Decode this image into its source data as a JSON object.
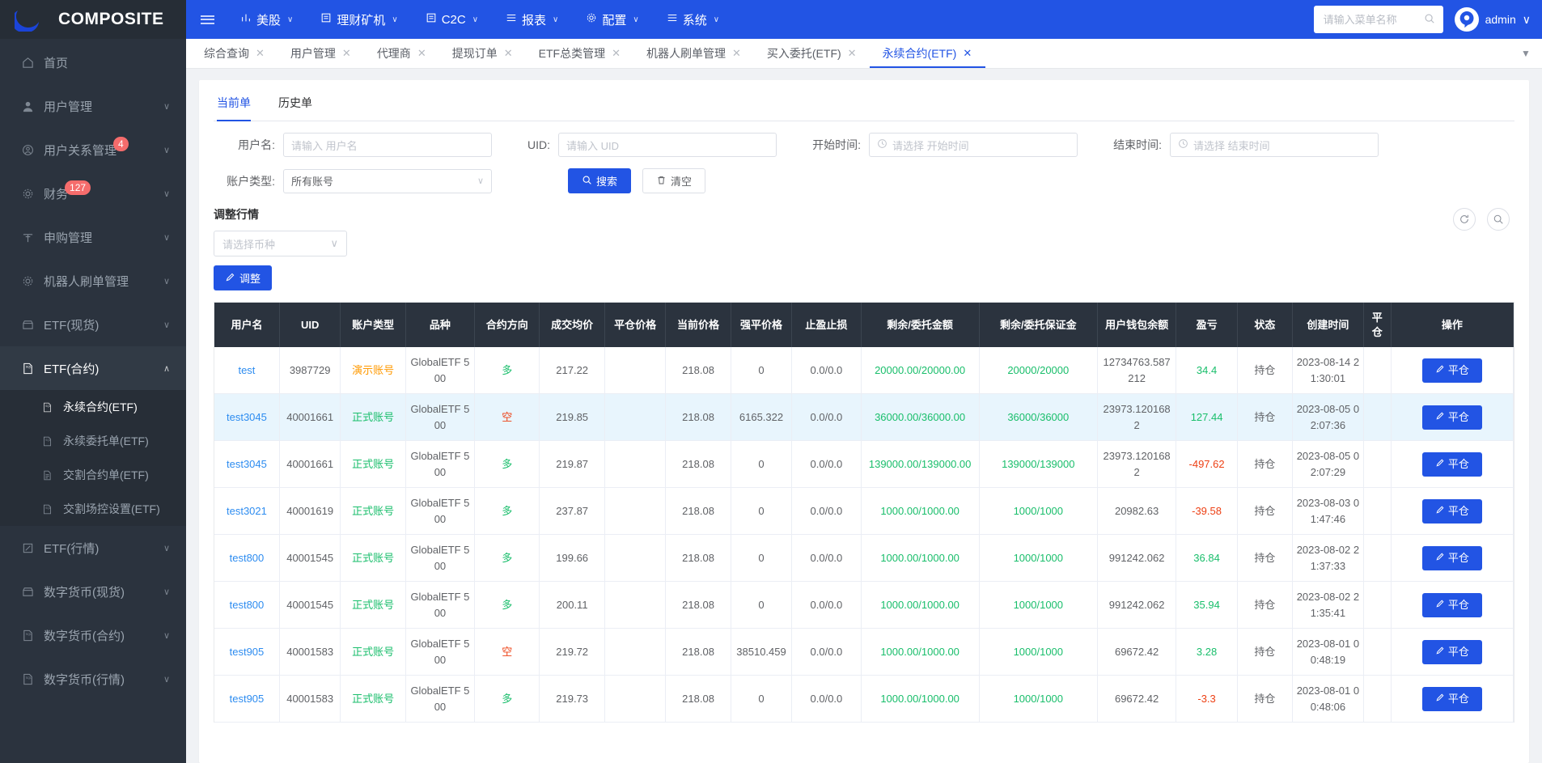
{
  "brand": {
    "name": "COMPOSITE",
    "logo_icon": "crescent-logo-icon"
  },
  "navbar": {
    "hamburger_icon": "hamburger-icon",
    "items": [
      {
        "label": "美股",
        "icon": "chart-bars-icon",
        "caret": "∨"
      },
      {
        "label": "理财矿机",
        "icon": "list-box-icon",
        "caret": "∨"
      },
      {
        "label": "C2C",
        "icon": "list-box-icon",
        "caret": "∨"
      },
      {
        "label": "报表",
        "icon": "list-lines-icon",
        "caret": "∨"
      },
      {
        "label": "配置",
        "icon": "gear-icon",
        "caret": "∨"
      },
      {
        "label": "系统",
        "icon": "list-lines-icon",
        "caret": "∨"
      }
    ],
    "search": {
      "placeholder": "请输入菜单名称",
      "icon": "search-icon"
    },
    "user": {
      "name": "admin",
      "avatar_icon": "robot-avatar-icon",
      "caret": "∨"
    }
  },
  "sidebar": {
    "items": [
      {
        "label": "首页",
        "icon": "home-icon",
        "badge": "",
        "arrow": "",
        "active": false
      },
      {
        "label": "用户管理",
        "icon": "user-icon",
        "badge": "",
        "arrow": "∨",
        "active": false
      },
      {
        "label": "用户关系管理",
        "icon": "user-circle-icon",
        "badge": "4",
        "arrow": "∨",
        "active": false
      },
      {
        "label": "财务",
        "icon": "gear-icon",
        "badge": "127",
        "arrow": "∨",
        "active": false
      },
      {
        "label": "申购管理",
        "icon": "cart-icon",
        "badge": "",
        "arrow": "∨",
        "active": false
      },
      {
        "label": "机器人刷单管理",
        "icon": "gear-icon",
        "badge": "",
        "arrow": "∨",
        "active": false
      },
      {
        "label": "ETF(现货)",
        "icon": "shop-icon",
        "badge": "",
        "arrow": "∨",
        "active": false
      },
      {
        "label": "ETF(合约)",
        "icon": "sql-doc-icon",
        "badge": "",
        "arrow": "∧",
        "active": true
      },
      {
        "label": "ETF(行情)",
        "icon": "pencil-square-icon",
        "badge": "",
        "arrow": "∨",
        "active": false
      },
      {
        "label": "数字货币(现货)",
        "icon": "shop-icon",
        "badge": "",
        "arrow": "∨",
        "active": false
      },
      {
        "label": "数字货币(合约)",
        "icon": "sql-doc-icon",
        "badge": "",
        "arrow": "∨",
        "active": false
      },
      {
        "label": "数字货币(行情)",
        "icon": "sql-doc-icon",
        "badge": "",
        "arrow": "∨",
        "active": false
      }
    ],
    "submenu": [
      {
        "label": "永续合约(ETF)",
        "icon": "sql-doc-icon",
        "active": true
      },
      {
        "label": "永续委托单(ETF)",
        "icon": "sql-doc-icon",
        "active": false
      },
      {
        "label": "交割合约单(ETF)",
        "icon": "doc-icon",
        "active": false
      },
      {
        "label": "交割场控设置(ETF)",
        "icon": "sql-doc-icon",
        "active": false
      }
    ]
  },
  "tabs": {
    "items": [
      {
        "label": "综合查询",
        "active": false
      },
      {
        "label": "用户管理",
        "active": false
      },
      {
        "label": "代理商",
        "active": false
      },
      {
        "label": "提现订单",
        "active": false
      },
      {
        "label": "ETF总类管理",
        "active": false
      },
      {
        "label": "机器人刷单管理",
        "active": false
      },
      {
        "label": "买入委托(ETF)",
        "active": false
      },
      {
        "label": "永续合约(ETF)",
        "active": true
      }
    ],
    "close_icon": "close-icon",
    "more_icon": "chevron-down-icon"
  },
  "inner_tabs": [
    {
      "label": "当前单",
      "active": true
    },
    {
      "label": "历史单",
      "active": false
    }
  ],
  "search_form": {
    "username": {
      "label": "用户名:",
      "value": "",
      "placeholder": "请输入 用户名"
    },
    "uid": {
      "label": "UID:",
      "value": "",
      "placeholder": "请输入 UID"
    },
    "start_time": {
      "label": "开始时间:",
      "value": "",
      "placeholder": "请选择 开始时间",
      "icon": "clock-icon"
    },
    "end_time": {
      "label": "结束时间:",
      "value": "",
      "placeholder": "请选择 结束时间",
      "icon": "clock-icon"
    },
    "account_type": {
      "label": "账户类型:",
      "value": "所有账号",
      "caret": "∨"
    },
    "search_button": {
      "label": "搜索",
      "icon": "search-icon"
    },
    "clear_button": {
      "label": "清空",
      "icon": "trash-icon"
    }
  },
  "adjust_panel": {
    "title": "调整行情",
    "coin_select": {
      "placeholder": "请选择币种",
      "caret": "∨"
    },
    "adjust_button": {
      "label": "调整",
      "icon": "pencil-icon"
    },
    "refresh_icon": "refresh-icon",
    "zoom_icon": "search-circle-icon"
  },
  "table": {
    "columns": [
      "用户名",
      "UID",
      "账户类型",
      "品种",
      "合约方向",
      "成交均价",
      "平仓价格",
      "当前价格",
      "强平价格",
      "止盈止损",
      "剩余/委托金额",
      "剩余/委托保证金",
      "用户钱包余额",
      "盈亏",
      "状态",
      "创建时间",
      "平仓",
      "操作"
    ],
    "action_label": "平仓",
    "action_icon": "pencil-icon",
    "rows": [
      {
        "username": "test",
        "uid": "3987729",
        "account_type": "演示账号",
        "account_type_color": "orange",
        "symbol": "GlobalETF 500",
        "direction": "多",
        "direction_color": "green",
        "avg_price": "217.22",
        "close_price": "",
        "current_price": "218.08",
        "liq_price": "0",
        "tp_sl": "0.0/0.0",
        "amount": "20000.00/20000.00",
        "margin": "20000/20000",
        "wallet": "12734763.587212",
        "pnl": "34.4",
        "pnl_color": "green",
        "status": "持仓",
        "created": "2023-08-14 21:30:01",
        "striped": false
      },
      {
        "username": "test3045",
        "uid": "40001661",
        "account_type": "正式账号",
        "account_type_color": "green",
        "symbol": "GlobalETF 500",
        "direction": "空",
        "direction_color": "red",
        "avg_price": "219.85",
        "close_price": "",
        "current_price": "218.08",
        "liq_price": "6165.322",
        "tp_sl": "0.0/0.0",
        "amount": "36000.00/36000.00",
        "margin": "36000/36000",
        "wallet": "23973.1201682",
        "pnl": "127.44",
        "pnl_color": "green",
        "status": "持仓",
        "created": "2023-08-05 02:07:36",
        "striped": true
      },
      {
        "username": "test3045",
        "uid": "40001661",
        "account_type": "正式账号",
        "account_type_color": "green",
        "symbol": "GlobalETF 500",
        "direction": "多",
        "direction_color": "green",
        "avg_price": "219.87",
        "close_price": "",
        "current_price": "218.08",
        "liq_price": "0",
        "tp_sl": "0.0/0.0",
        "amount": "139000.00/139000.00",
        "margin": "139000/139000",
        "wallet": "23973.1201682",
        "pnl": "-497.62",
        "pnl_color": "red",
        "status": "持仓",
        "created": "2023-08-05 02:07:29",
        "striped": false
      },
      {
        "username": "test3021",
        "uid": "40001619",
        "account_type": "正式账号",
        "account_type_color": "green",
        "symbol": "GlobalETF 500",
        "direction": "多",
        "direction_color": "green",
        "avg_price": "237.87",
        "close_price": "",
        "current_price": "218.08",
        "liq_price": "0",
        "tp_sl": "0.0/0.0",
        "amount": "1000.00/1000.00",
        "margin": "1000/1000",
        "wallet": "20982.63",
        "pnl": "-39.58",
        "pnl_color": "red",
        "status": "持仓",
        "created": "2023-08-03 01:47:46",
        "striped": false
      },
      {
        "username": "test800",
        "uid": "40001545",
        "account_type": "正式账号",
        "account_type_color": "green",
        "symbol": "GlobalETF 500",
        "direction": "多",
        "direction_color": "green",
        "avg_price": "199.66",
        "close_price": "",
        "current_price": "218.08",
        "liq_price": "0",
        "tp_sl": "0.0/0.0",
        "amount": "1000.00/1000.00",
        "margin": "1000/1000",
        "wallet": "991242.062",
        "pnl": "36.84",
        "pnl_color": "green",
        "status": "持仓",
        "created": "2023-08-02 21:37:33",
        "striped": false
      },
      {
        "username": "test800",
        "uid": "40001545",
        "account_type": "正式账号",
        "account_type_color": "green",
        "symbol": "GlobalETF 500",
        "direction": "多",
        "direction_color": "green",
        "avg_price": "200.11",
        "close_price": "",
        "current_price": "218.08",
        "liq_price": "0",
        "tp_sl": "0.0/0.0",
        "amount": "1000.00/1000.00",
        "margin": "1000/1000",
        "wallet": "991242.062",
        "pnl": "35.94",
        "pnl_color": "green",
        "status": "持仓",
        "created": "2023-08-02 21:35:41",
        "striped": false
      },
      {
        "username": "test905",
        "uid": "40001583",
        "account_type": "正式账号",
        "account_type_color": "green",
        "symbol": "GlobalETF 500",
        "direction": "空",
        "direction_color": "red",
        "avg_price": "219.72",
        "close_price": "",
        "current_price": "218.08",
        "liq_price": "38510.459",
        "tp_sl": "0.0/0.0",
        "amount": "1000.00/1000.00",
        "margin": "1000/1000",
        "wallet": "69672.42",
        "pnl": "3.28",
        "pnl_color": "green",
        "status": "持仓",
        "created": "2023-08-01 00:48:19",
        "striped": false
      },
      {
        "username": "test905",
        "uid": "40001583",
        "account_type": "正式账号",
        "account_type_color": "green",
        "symbol": "GlobalETF 500",
        "direction": "多",
        "direction_color": "green",
        "avg_price": "219.73",
        "close_price": "",
        "current_price": "218.08",
        "liq_price": "0",
        "tp_sl": "0.0/0.0",
        "amount": "1000.00/1000.00",
        "margin": "1000/1000",
        "wallet": "69672.42",
        "pnl": "-3.3",
        "pnl_color": "red",
        "status": "持仓",
        "created": "2023-08-01 00:48:06",
        "striped": false
      }
    ]
  },
  "colors": {
    "brand_blue": "#2254e4",
    "sidebar_dark": "#2b333e",
    "green": "#19be6b",
    "red": "#ed4014",
    "orange": "#ff9900",
    "link": "#2d8cf0",
    "stripe": "#e8f5fd"
  }
}
